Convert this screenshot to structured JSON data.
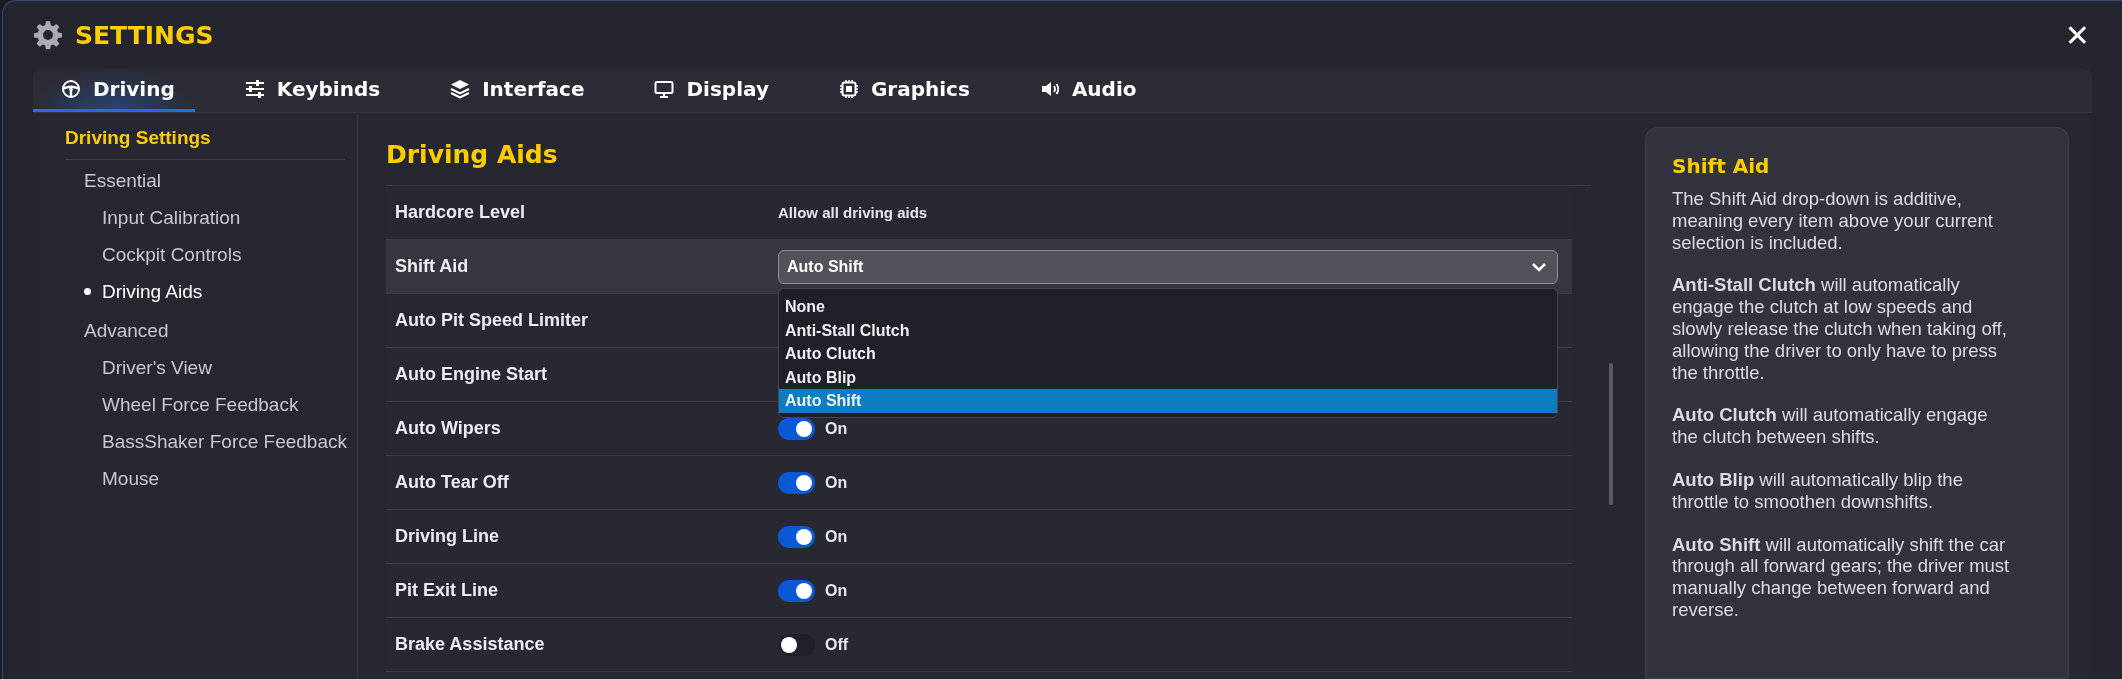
{
  "window": {
    "title": "SETTINGS",
    "close": "✕"
  },
  "tabs": [
    {
      "label": "Driving",
      "selected": true
    },
    {
      "label": "Keybinds",
      "selected": false
    },
    {
      "label": "Interface",
      "selected": false
    },
    {
      "label": "Display",
      "selected": false
    },
    {
      "label": "Graphics",
      "selected": false
    },
    {
      "label": "Audio",
      "selected": false
    }
  ],
  "sidebar": {
    "heading": "Driving Settings",
    "groups": [
      {
        "label": "Essential",
        "children": [
          {
            "label": "Input Calibration",
            "selected": false
          },
          {
            "label": "Cockpit Controls",
            "selected": false
          },
          {
            "label": "Driving Aids",
            "selected": true
          }
        ]
      },
      {
        "label": "Advanced",
        "children": [
          {
            "label": "Driver's View",
            "selected": false
          },
          {
            "label": "Wheel Force Feedback",
            "selected": false
          },
          {
            "label": "BassShaker Force Feedback",
            "selected": false
          },
          {
            "label": "Mouse",
            "selected": false
          }
        ]
      }
    ]
  },
  "section": {
    "title": "Driving Aids",
    "rows": [
      {
        "label": "Hardcore Level",
        "kind": "text",
        "value": "Allow all driving aids",
        "selected": false
      },
      {
        "label": "Shift Aid",
        "kind": "select",
        "value": "Auto Shift",
        "selected": true
      },
      {
        "label": "Auto Pit Speed Limiter",
        "kind": "covered",
        "selected": false
      },
      {
        "label": "Auto Engine Start",
        "kind": "covered",
        "selected": false
      },
      {
        "label": "Auto Wipers",
        "kind": "toggle",
        "on": true,
        "state_label": "On",
        "selected": false
      },
      {
        "label": "Auto Tear Off",
        "kind": "toggle",
        "on": true,
        "state_label": "On",
        "selected": false
      },
      {
        "label": "Driving Line",
        "kind": "toggle",
        "on": true,
        "state_label": "On",
        "selected": false
      },
      {
        "label": "Pit Exit Line",
        "kind": "toggle",
        "on": true,
        "state_label": "On",
        "selected": false
      },
      {
        "label": "Brake Assistance",
        "kind": "toggle",
        "on": false,
        "state_label": "Off",
        "selected": false
      }
    ],
    "dropdown": {
      "options": [
        {
          "label": "None",
          "selected": false
        },
        {
          "label": "Anti-Stall Clutch",
          "selected": false
        },
        {
          "label": "Auto Clutch",
          "selected": false
        },
        {
          "label": "Auto Blip",
          "selected": false
        },
        {
          "label": "Auto Shift",
          "selected": true
        }
      ]
    }
  },
  "help": {
    "title": "Shift Aid",
    "paragraphs": [
      "The Shift Aid drop-down is additive, meaning every item above your current selection is included.",
      "**Anti-Stall Clutch** will automatically engage the clutch at low speeds and slowly release the clutch when taking off, allowing the driver to only have to press the throttle.",
      "**Auto Clutch** will automatically engage the clutch between shifts.",
      "**Auto Blip** will automatically blip the throttle to smoothen downshifts.",
      "**Auto Shift** will automatically shift the car through all forward gears; the driver must manually change between forward and reverse."
    ]
  }
}
